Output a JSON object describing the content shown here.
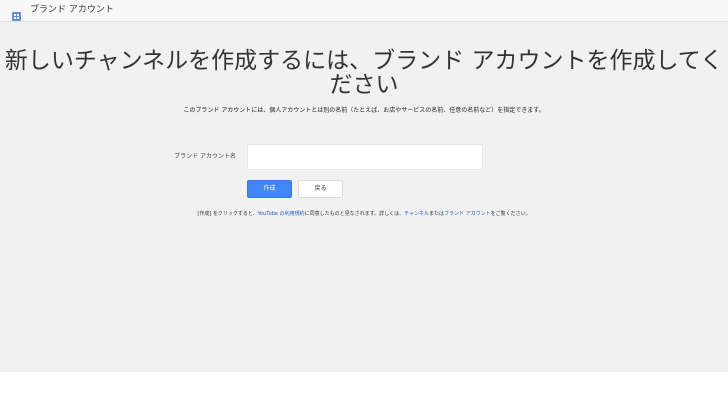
{
  "header": {
    "icon": "brand-account-icon",
    "title": "ブランド アカウント"
  },
  "main": {
    "title": "新しいチャンネルを作成するには、ブランド アカウントを作成してください",
    "description": "このブランド アカウントには、個人アカウントとは別の名前（たとえば、お店やサービスの名前、任意の名前など）を指定できます。",
    "form": {
      "label": "ブランド アカウント名",
      "value": "",
      "placeholder": ""
    },
    "buttons": {
      "create": "作成",
      "back": "戻る"
    },
    "terms": {
      "part1": "[作成] をクリックすると、",
      "link_terms": "YouTube の利用規約",
      "part2": "に同意したものと見なされます。詳しくは、",
      "link_channel": "チャンネル",
      "part3": "または",
      "link_brand": "ブランド アカウント",
      "part4": "をご覧ください。"
    }
  },
  "colors": {
    "primary_button": "#4285f4",
    "link": "#2a56c6",
    "background": "#f1f1f1"
  }
}
